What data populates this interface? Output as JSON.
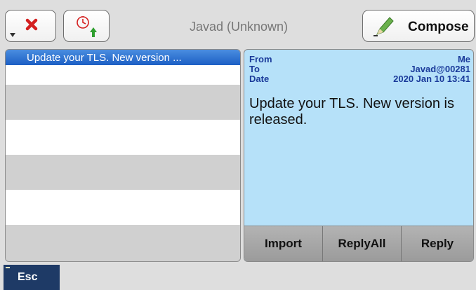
{
  "header": {
    "title": "Javad (Unknown)",
    "compose_label": "Compose"
  },
  "icons": {
    "delete": "close-icon",
    "sort": "timer-up-icon",
    "compose": "pencil-icon",
    "dropdown": "chevron-down-icon"
  },
  "message_list": {
    "items": [
      {
        "subject": "Update your TLS. New version ..."
      }
    ]
  },
  "message": {
    "from_label": "From",
    "to_label": "To",
    "date_label": "Date",
    "from_value": "Me",
    "to_value": "Javad@00281",
    "date_value": "2020 Jan 10 13:41",
    "body": "Update your TLS. New version is released."
  },
  "actions": {
    "import": "Import",
    "reply_all": "ReplyAll",
    "reply": "Reply"
  },
  "footer": {
    "esc_label": "Esc"
  },
  "colors": {
    "selected_row": "#2a6fd6",
    "message_bg": "#b6e1f9",
    "header_text": "#1a3a9a",
    "delete_red": "#d42020",
    "arrow_green": "#2f9e2f",
    "esc_bg": "#1e3a66"
  }
}
